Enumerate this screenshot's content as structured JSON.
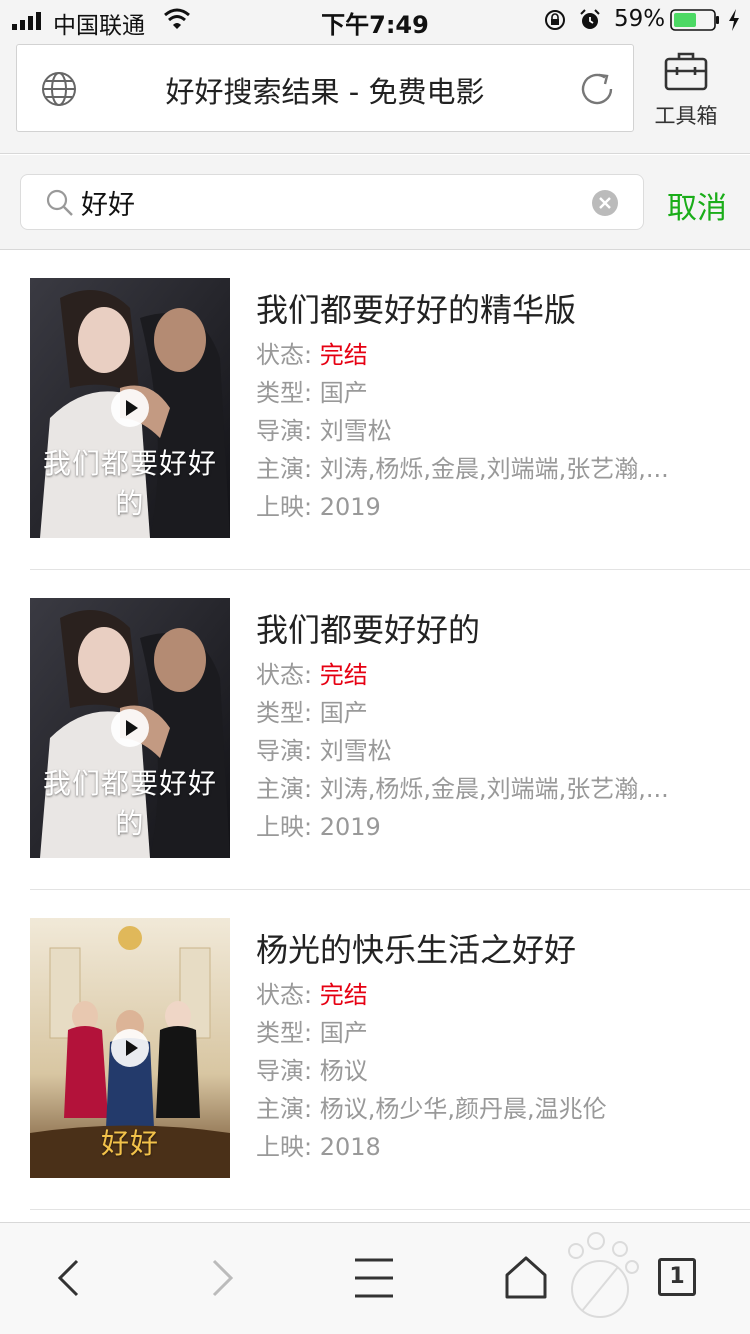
{
  "status_bar": {
    "carrier": "中国联通",
    "time": "下午7:49",
    "battery": "59%",
    "battery_level": 0.59
  },
  "header": {
    "page_title": "好好搜索结果 - 免费电影",
    "toolbox_label": "工具箱"
  },
  "search": {
    "value": "好好",
    "cancel_label": "取消"
  },
  "labels": {
    "status": "状态:",
    "genre": "类型:",
    "director": "导演:",
    "cast": "主演:",
    "release": "上映:"
  },
  "results": [
    {
      "title": "我们都要好好的精华版",
      "status": "完结",
      "genre": "国产",
      "director": "刘雪松",
      "cast": "刘涛,杨烁,金晨,刘端端,张艺瀚,...",
      "release": "2019",
      "poster_caption": "我们都要好好的"
    },
    {
      "title": "我们都要好好的",
      "status": "完结",
      "genre": "国产",
      "director": "刘雪松",
      "cast": "刘涛,杨烁,金晨,刘端端,张艺瀚,...",
      "release": "2019",
      "poster_caption": "我们都要好好的"
    },
    {
      "title": "杨光的快乐生活之好好",
      "status": "完结",
      "genre": "国产",
      "director": "杨议",
      "cast": "杨议,杨少华,颜丹晨,温兆伦",
      "release": "2018",
      "poster_caption": "好好"
    }
  ],
  "bottom_bar": {
    "tab_count": "1"
  },
  "colors": {
    "accent_green": "#1aad19",
    "status_red": "#e60012"
  }
}
